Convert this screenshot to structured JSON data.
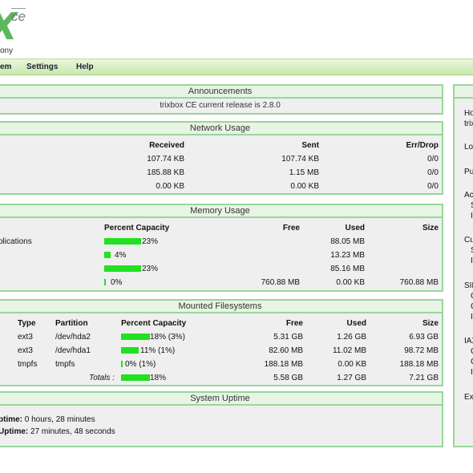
{
  "logo": {
    "ce": "ce",
    "sub": "ony"
  },
  "nav": [
    "em",
    "Settings",
    "Help"
  ],
  "announcements": {
    "title": "Announcements",
    "text": "trixbox CE current release is 2.8.0"
  },
  "network": {
    "title": "Network Usage",
    "headers": [
      "Received",
      "Sent",
      "Err/Drop"
    ],
    "rows": [
      [
        "107.74 KB",
        "107.74 KB",
        "0/0"
      ],
      [
        "185.88 KB",
        "1.15 MB",
        "0/0"
      ],
      [
        "0.00 KB",
        "0.00 KB",
        "0/0"
      ]
    ]
  },
  "memory": {
    "title": "Memory Usage",
    "headers": [
      "Percent Capacity",
      "Free",
      "Used",
      "Size"
    ],
    "rows": [
      {
        "label": "plications",
        "pct": "23%",
        "fill": 0.23,
        "free": "",
        "used": "88.05 MB",
        "size": ""
      },
      {
        "label": "",
        "pct": "4%",
        "fill": 0.04,
        "free": "",
        "used": "13.23 MB",
        "size": ""
      },
      {
        "label": "",
        "pct": "23%",
        "fill": 0.23,
        "free": "",
        "used": "85.16 MB",
        "size": ""
      },
      {
        "label": "",
        "pct": "0%",
        "fill": 0.0,
        "free": "760.88 MB",
        "used": "0.00 KB",
        "size": "760.88 MB"
      }
    ]
  },
  "filesystems": {
    "title": "Mounted Filesystems",
    "headers": [
      "Type",
      "Partition",
      "Percent Capacity",
      "Free",
      "Used",
      "Size"
    ],
    "rows": [
      {
        "type": "ext3",
        "partition": "/dev/hda2",
        "pct": "18% (3%)",
        "fill": 0.18,
        "free": "5.31 GB",
        "used": "1.26 GB",
        "size": "6.93 GB"
      },
      {
        "type": "ext3",
        "partition": "/dev/hda1",
        "pct": "11% (1%)",
        "fill": 0.11,
        "free": "82.60 MB",
        "used": "11.02 MB",
        "size": "98.72 MB"
      },
      {
        "type": "tmpfs",
        "partition": "tmpfs",
        "pct": "0% (1%)",
        "fill": 0.0,
        "free": "188.18 MB",
        "used": "0.00 KB",
        "size": "188.18 MB"
      }
    ],
    "totals": {
      "label": "Totals :",
      "pct": "18%",
      "fill": 0.18,
      "free": "5.58 GB",
      "used": "1.27 GB",
      "size": "7.21 GB"
    }
  },
  "uptime": {
    "title": "System Uptime",
    "line1_label": "ptime:",
    "line1_value": " 0 hours, 28 minutes",
    "line2_label": "Uptime:",
    "line2_value": " 27 minutes, 48 seconds"
  },
  "right_panel": {
    "items": [
      "Ho",
      "trix",
      "Lo",
      "Pu",
      "Ac",
      "S",
      "I",
      "Cu",
      "S",
      "I",
      "SIF",
      "C",
      "C",
      "I",
      "IAX",
      "C",
      "C",
      "I",
      "Ex"
    ]
  }
}
